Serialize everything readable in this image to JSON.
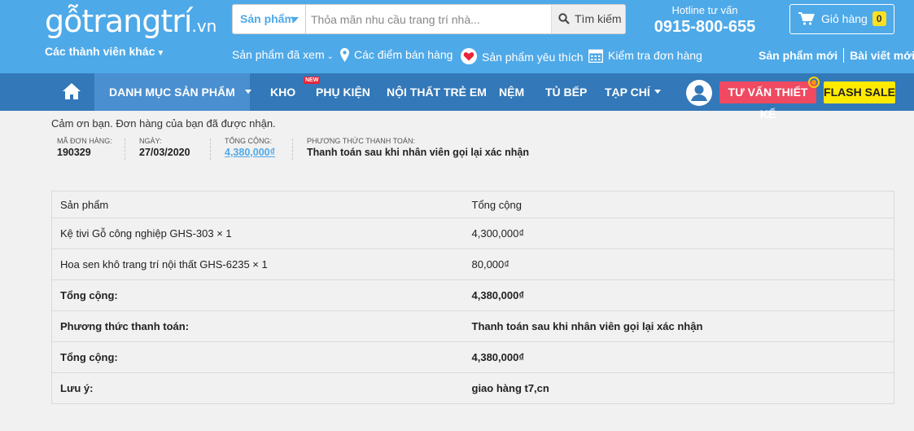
{
  "header": {
    "logo_main": "gỗtrangtrí",
    "logo_domain": ".vn",
    "members_label": "Các thành viên khác",
    "search": {
      "category": "Sản phẩm",
      "placeholder": "Thỏa mãn nhu cầu trang trí nhà...",
      "button_label": "Tìm kiếm"
    },
    "hotline_title": "Hotline tư vấn",
    "hotline_number": "0915-800-655",
    "cart_label": "Giỏ hàng",
    "cart_count": "0",
    "sublinks": {
      "viewed": "Sản phẩm đã xem",
      "stores": "Các điểm bán hàng",
      "favorites": "Sản phẩm yêu thích",
      "check_order": "Kiểm tra đơn hàng"
    },
    "new_products": "Sản phẩm mới",
    "new_posts": "Bài viết mới"
  },
  "nav": {
    "categories": "DANH MỤC SẢN PHẨM",
    "kho": "KHO",
    "phu_kien": "PHỤ KIỆN",
    "new_badge": "NEW",
    "kids": "NỘI THẤT TRẺ EM",
    "nem": "NỆM",
    "tu_bep": "TỦ BẾP",
    "tap_chi": "TẠP CHÍ",
    "design_btn": "TƯ VẤN THIẾT KẾ",
    "flash_btn": "FLASH SALE"
  },
  "order": {
    "thanks": "Cảm ơn bạn. Đơn hàng của bạn đã được nhận.",
    "number_label": "MÃ ĐƠN HÀNG:",
    "number": "190329",
    "date_label": "NGÀY:",
    "date": "27/03/2020",
    "total_label": "TỔNG CỘNG:",
    "total": "4,380,000₫",
    "payment_label": "PHƯƠNG THỨC THANH TOÁN:",
    "payment": "Thanh toán sau khi nhân viên gọi lại xác nhận"
  },
  "table": {
    "headers": [
      "Sản phẩm",
      "Tổng cộng"
    ],
    "rows": [
      {
        "label": "Kệ tivi Gỗ công nghiệp GHS-303 × 1",
        "value": "4,300,000₫"
      },
      {
        "label": "Hoa sen khô trang trí nội thất GHS-6235 × 1",
        "value": "80,000₫"
      },
      {
        "label": "Tổng cộng:",
        "value": "4,380,000₫"
      },
      {
        "label": "Phương thức thanh toán:",
        "value": "Thanh toán sau khi nhân viên gọi lại xác nhận"
      },
      {
        "label": "Tổng cộng:",
        "value": "4,380,000₫"
      },
      {
        "label": "Lưu ý:",
        "value": "giao hàng t7,cn"
      }
    ]
  }
}
